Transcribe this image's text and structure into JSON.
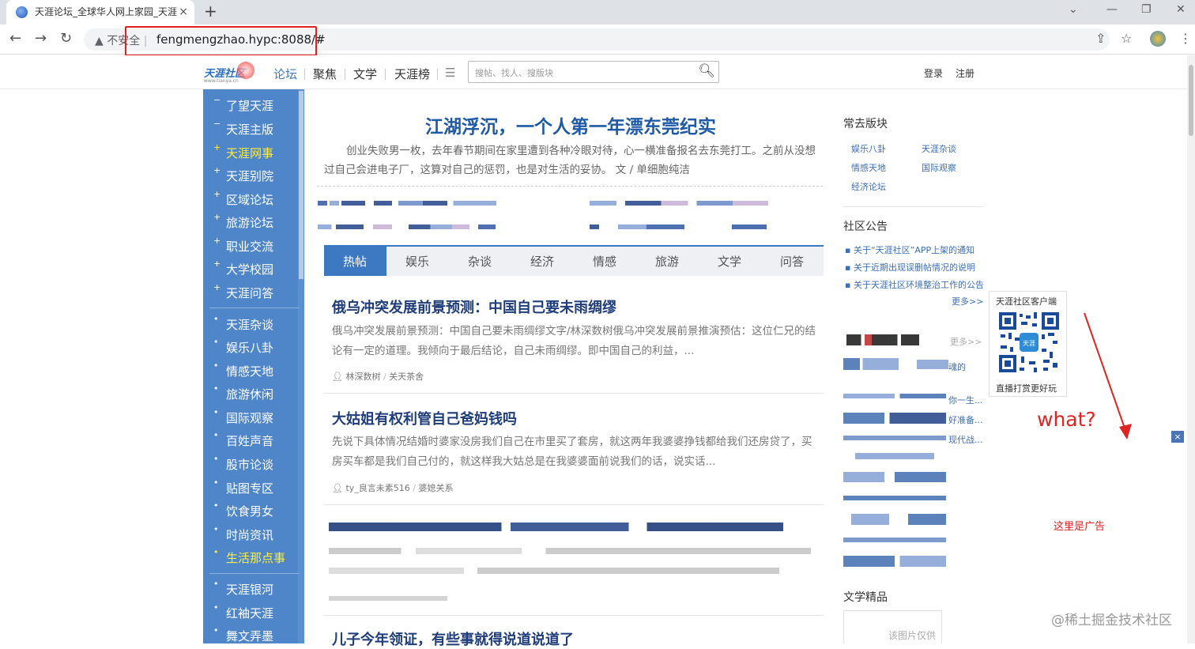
{
  "browser": {
    "tab_title": "天涯论坛_全球华人网上家园_天涯",
    "tab_close": "×",
    "new_tab": "+",
    "not_secure": "不安全",
    "url": "fengmengzhao.hypc:8088/#"
  },
  "site_header": {
    "logo_text": "天涯社区",
    "logo_sub": "www.tianya.cn",
    "nav": [
      "论坛",
      "聚焦",
      "文学",
      "天涯榜"
    ],
    "search_placeholder": "搜帖、找人、搜版块",
    "login": "登录",
    "register": "注册"
  },
  "sidebar": {
    "group1": [
      {
        "mark": "−",
        "label": "了望天涯"
      },
      {
        "mark": "−",
        "label": "天涯主版"
      },
      {
        "mark": "+",
        "label": "天涯网事",
        "highlight": true
      },
      {
        "mark": "+",
        "label": "天涯别院"
      },
      {
        "mark": "+",
        "label": "区域论坛"
      },
      {
        "mark": "+",
        "label": "旅游论坛"
      },
      {
        "mark": "+",
        "label": "职业交流"
      },
      {
        "mark": "+",
        "label": "大学校园"
      },
      {
        "mark": "+",
        "label": "天涯问答"
      }
    ],
    "group2": [
      {
        "mark": "•",
        "label": "天涯杂谈"
      },
      {
        "mark": "•",
        "label": "娱乐八卦"
      },
      {
        "mark": "•",
        "label": "情感天地"
      },
      {
        "mark": "•",
        "label": "旅游休闲"
      },
      {
        "mark": "•",
        "label": "国际观察"
      },
      {
        "mark": "•",
        "label": "百姓声音"
      },
      {
        "mark": "•",
        "label": "股市论谈"
      },
      {
        "mark": "•",
        "label": "贴图专区"
      },
      {
        "mark": "•",
        "label": "饮食男女"
      },
      {
        "mark": "•",
        "label": "时尚资讯"
      },
      {
        "mark": "•",
        "label": "生活那点事",
        "highlight": true
      }
    ],
    "group3": [
      {
        "mark": "•",
        "label": "天涯银河"
      },
      {
        "mark": "•",
        "label": "红袖天涯"
      },
      {
        "mark": "•",
        "label": "舞文弄墨"
      }
    ]
  },
  "main": {
    "headline": "江湖浮沉，一个人第一年漂东莞纪实",
    "lead": "创业失败男一枚，去年春节期间在家里遭到各种冷眼对待，心一横准备报名去东莞打工。之前从没想过自己会进电子厂，这算对自己的惩罚，也是对生活的妥协。 文 / 单细胞纯洁",
    "tabs": [
      "热帖",
      "娱乐",
      "杂谈",
      "经济",
      "情感",
      "旅游",
      "文学",
      "问答"
    ],
    "articles": [
      {
        "title": "俄乌冲突发展前景预测：中国自己要未雨绸缪",
        "body": "俄乌冲突发展前景预测：中国自己要未雨绸缪文字/林深数树俄乌冲突发展前景推演预估：这位仁兄的结论有一定的道理。我倾向于最后结论，自己未雨绸缪。即中国自己的利益，...",
        "author": "林深数树",
        "board": "关天茶舍"
      },
      {
        "title": "大姑姐有权利管自己爸妈钱吗",
        "body": "先说下具体情况结婚时婆家没房我们自己在市里买了套房，就这两年我婆婆挣钱都给我们还房贷了，买房买车都是我们自己付的，就这样我大姑总是在我婆婆面前说我们的话，说实话...",
        "author": "ty_良言未素516",
        "board": "婆媳关系"
      },
      {
        "title": "儿子今年领证，有些事就得说道说道了",
        "body": "",
        "author": "",
        "board": ""
      }
    ]
  },
  "right": {
    "frequent_title": "常去版块",
    "frequent": [
      "娱乐八卦",
      "天涯杂谈",
      "情感天地",
      "国际观察",
      "经济论坛"
    ],
    "notice_title": "社区公告",
    "notices": [
      "关于“天涯社区”APP上架的通知",
      "关于近期出现误删帖情况的说明",
      "关于天涯社区环境整治工作的公告"
    ],
    "more": "更多>>",
    "more2": "更多>>",
    "partial1": "魂的",
    "partial2": "你一生...",
    "partial3": "好准备...",
    "partial4": "现代战...",
    "qr_title": "天涯社区客户端",
    "qr_bottom": "直播打赏更好玩",
    "literature_title": "文学精品",
    "literature_placeholder": "该图片仅供"
  },
  "annotations": {
    "what": "what?",
    "ad_text": "这里是广告",
    "ad_close": "×",
    "watermark": "@稀土掘金技术社区"
  },
  "colors": {
    "accent": "#3d78c2",
    "sidebar_bg": "#4f86c9",
    "highlight": "#ffec3d",
    "annotation_red": "#e02424"
  }
}
